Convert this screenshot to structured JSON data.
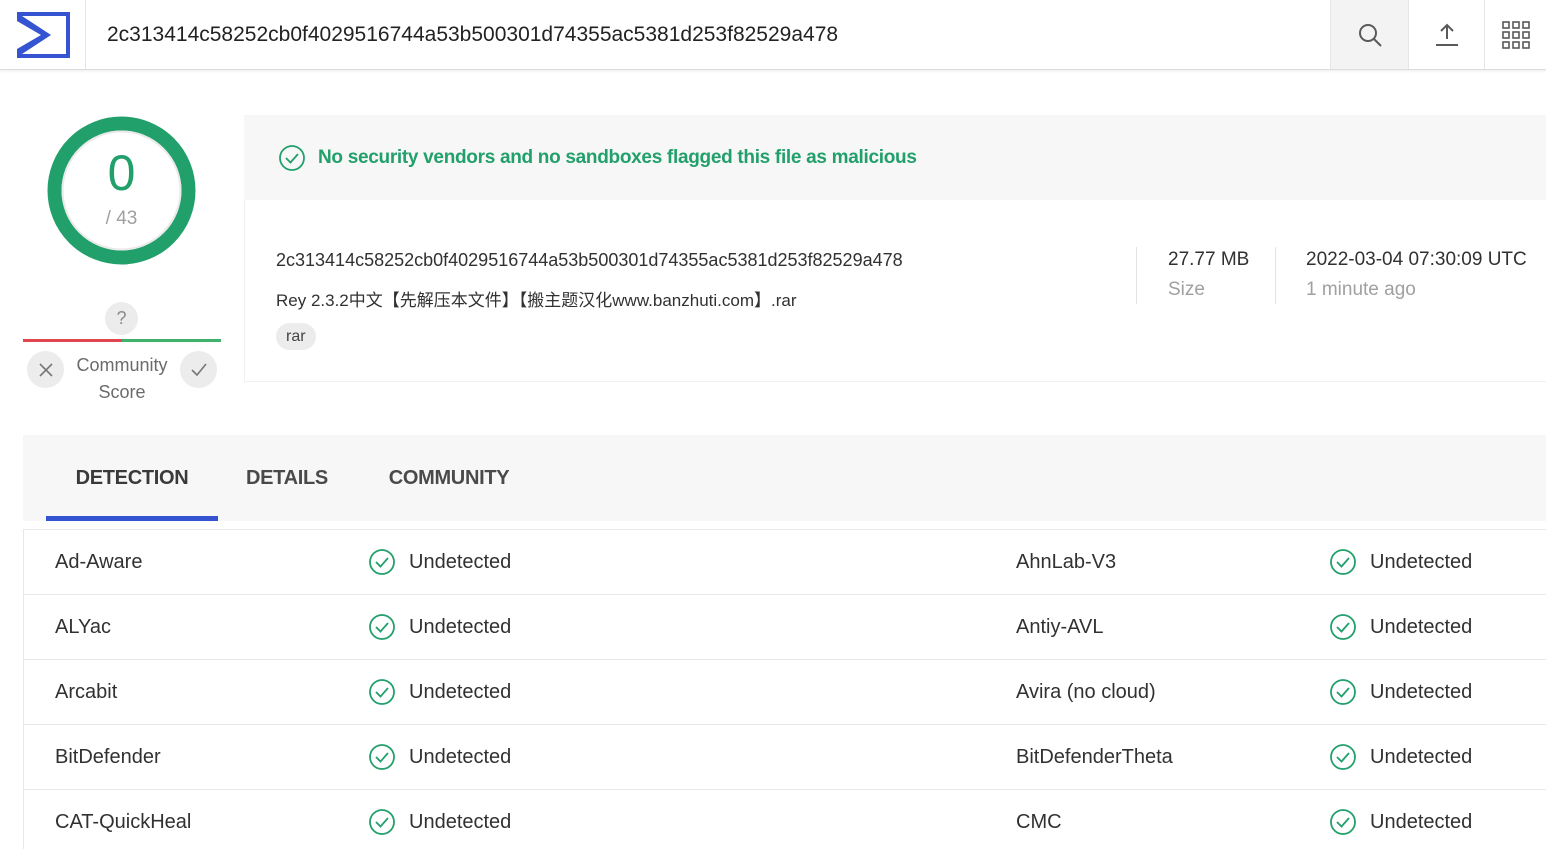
{
  "header": {
    "search_value": "2c313414c58252cb0f4029516744a53b500301d74355ac5381d253f82529a478",
    "icons": [
      "sigma-logo-icon",
      "search-icon",
      "upload-icon",
      "apps-grid-icon"
    ]
  },
  "score": {
    "detections": "0",
    "total": "/ 43",
    "ring_color": "#22a06b"
  },
  "community": {
    "unknown": "?",
    "label_line1": "Community",
    "label_line2": "Score"
  },
  "banner": {
    "message": "No security vendors and no sandboxes flagged this file as malicious",
    "color": "#22a06b"
  },
  "file": {
    "hash": "2c313414c58252cb0f4029516744a53b500301d74355ac5381d253f82529a478",
    "name": "Rey 2.3.2中文【先解压本文件】【搬主题汉化www.banzhuti.com】.rar",
    "tag": "rar",
    "size_value": "27.77 MB",
    "size_label": "Size",
    "date_value": "2022-03-04 07:30:09 UTC",
    "date_label": "1 minute ago"
  },
  "tabs": {
    "detection": "DETECTION",
    "details": "DETAILS",
    "community": "COMMUNITY",
    "active": "detection",
    "accent": "#3454d1"
  },
  "detections": [
    {
      "left_vendor": "Ad-Aware",
      "left_result": "Undetected",
      "right_vendor": "AhnLab-V3",
      "right_result": "Undetected"
    },
    {
      "left_vendor": "ALYac",
      "left_result": "Undetected",
      "right_vendor": "Antiy-AVL",
      "right_result": "Undetected"
    },
    {
      "left_vendor": "Arcabit",
      "left_result": "Undetected",
      "right_vendor": "Avira (no cloud)",
      "right_result": "Undetected"
    },
    {
      "left_vendor": "BitDefender",
      "left_result": "Undetected",
      "right_vendor": "BitDefenderTheta",
      "right_result": "Undetected"
    },
    {
      "left_vendor": "CAT-QuickHeal",
      "left_result": "Undetected",
      "right_vendor": "CMC",
      "right_result": "Undetected"
    }
  ]
}
